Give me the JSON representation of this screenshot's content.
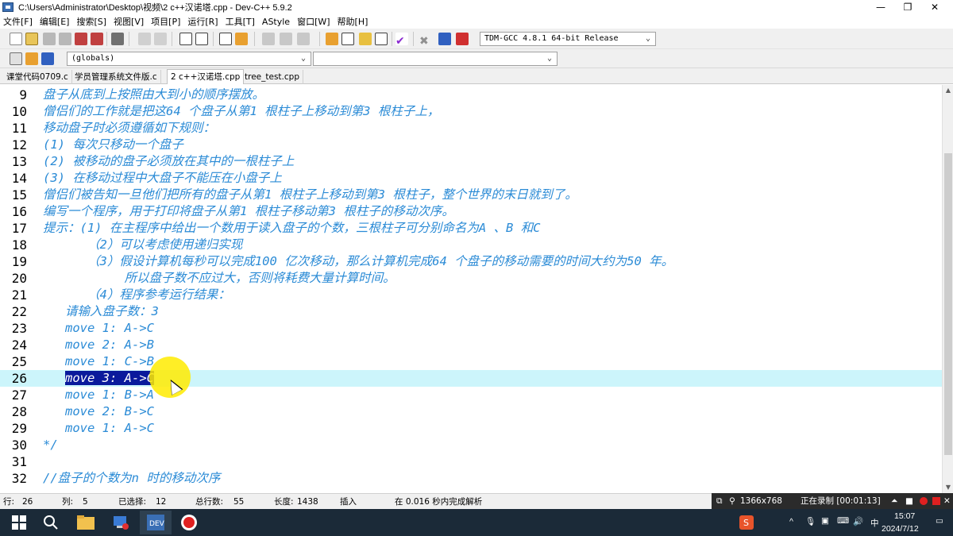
{
  "window": {
    "title": "C:\\Users\\Administrator\\Desktop\\视频\\2 c++汉诺塔.cpp - Dev-C++ 5.9.2",
    "min": "—",
    "max": "❐",
    "close": "✕"
  },
  "menu": [
    "文件[F]",
    "编辑[E]",
    "搜索[S]",
    "视图[V]",
    "项目[P]",
    "运行[R]",
    "工具[T]",
    "AStyle",
    "窗口[W]",
    "帮助[H]"
  ],
  "toolbar": {
    "compiler": "TDM-GCC 4.8.1 64-bit Release",
    "scope": "(globals)",
    "symbol": ""
  },
  "tabs": [
    "课堂代码0709.c",
    "学员管理系统文件版.c",
    "2 c++汉诺塔.cpp",
    "tree_test.cpp"
  ],
  "editor": {
    "lines": [
      {
        "n": "9",
        "text": "盘子从底到上按照由大到小的顺序摆放。"
      },
      {
        "n": "10",
        "text": "僧侣们的工作就是把这64 个盘子从第1 根柱子上移动到第3 根柱子上，"
      },
      {
        "n": "11",
        "text": "移动盘子时必须遵循如下规则："
      },
      {
        "n": "12",
        "text": "(1) 每次只移动一个盘子"
      },
      {
        "n": "13",
        "text": "(2) 被移动的盘子必须放在其中的一根柱子上"
      },
      {
        "n": "14",
        "text": "(3) 在移动过程中大盘子不能压在小盘子上"
      },
      {
        "n": "15",
        "text": "僧侣们被告知一旦他们把所有的盘子从第1 根柱子上移动到第3 根柱子，整个世界的末日就到了。"
      },
      {
        "n": "16",
        "text": "编写一个程序，用于打印将盘子从第1 根柱子移动第3 根柱子的移动次序。"
      },
      {
        "n": "17",
        "text": "提示：(1) 在主程序中给出一个数用于读入盘子的个数，三根柱子可分别命名为A 、B 和C"
      },
      {
        "n": "18",
        "text": "      （2）可以考虑使用递归实现"
      },
      {
        "n": "19",
        "text": "      （3）假设计算机每秒可以完成100 亿次移动，那么计算机完成64 个盘子的移动需要的时间大约为50 年。"
      },
      {
        "n": "20",
        "text": "           所以盘子数不应过大，否则将耗费大量计算时间。"
      },
      {
        "n": "21",
        "text": "      （4）程序参考运行结果："
      },
      {
        "n": "22",
        "text": "   请输入盘子数：3"
      },
      {
        "n": "23",
        "text": "   move 1: A->C"
      },
      {
        "n": "24",
        "text": "   move 2: A->B"
      },
      {
        "n": "25",
        "text": "   move 1: C->B"
      },
      {
        "n": "26",
        "text": "",
        "pre": "   ",
        "selected": "move 3: A->C"
      },
      {
        "n": "27",
        "text": "   move 1: B->A"
      },
      {
        "n": "28",
        "text": "   move 2: B->C"
      },
      {
        "n": "29",
        "text": "   move 1: A->C"
      },
      {
        "n": "30",
        "text": "*/"
      },
      {
        "n": "31",
        "text": ""
      },
      {
        "n": "32",
        "text": "//盘子的个数为n 时的移动次序"
      }
    ]
  },
  "status": {
    "row_label": "行:",
    "row": "26",
    "col_label": "列:",
    "col": "5",
    "sel_label": "已选择:",
    "sel": "12",
    "total_label": "总行数:",
    "total": "55",
    "len_label": "长度:",
    "len": "1438",
    "mode": "插入",
    "parse": "在 0.016 秒内完成解析"
  },
  "recorder": {
    "resolution": "1366x768",
    "recording": "正在录制 [00:01:13]"
  },
  "tray": {
    "time": "15:07",
    "date": "2024/7/12"
  },
  "colors": {
    "comment": "#2b8bd6",
    "selection": "#0a1a9c",
    "current_line": "#ccf5fb",
    "taskbar": "#1b2a38"
  }
}
